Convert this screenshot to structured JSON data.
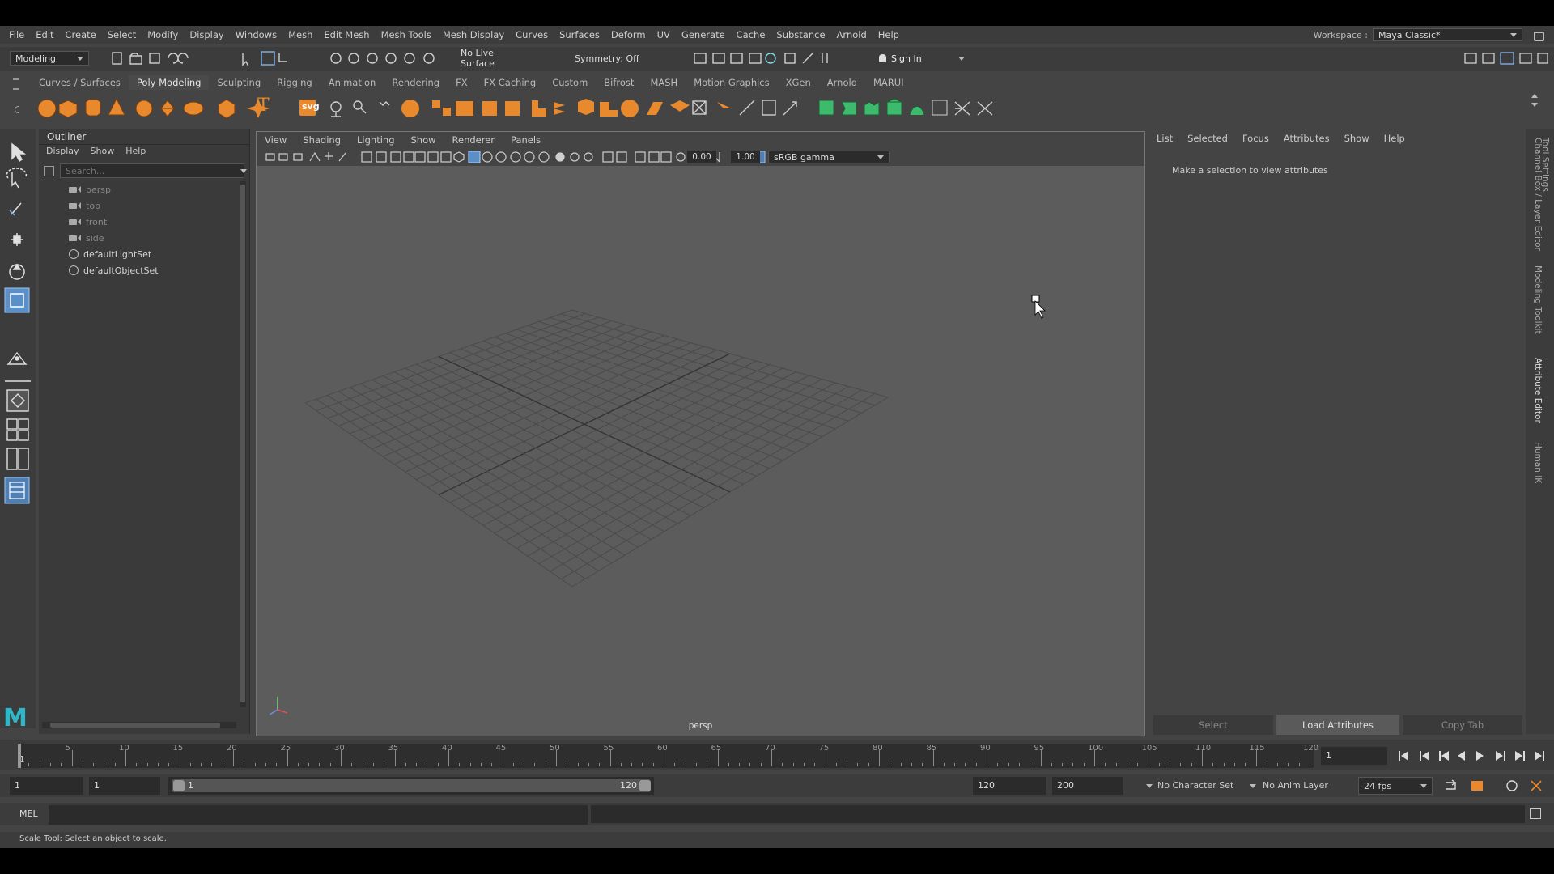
{
  "menubar": {
    "items": [
      "File",
      "Edit",
      "Create",
      "Select",
      "Modify",
      "Display",
      "Windows",
      "Mesh",
      "Edit Mesh",
      "Mesh Tools",
      "Mesh Display",
      "Curves",
      "Surfaces",
      "Deform",
      "UV",
      "Generate",
      "Cache",
      "Substance",
      "Arnold",
      "Help"
    ],
    "workspace_label": "Workspace :",
    "workspace_value": "Maya Classic*"
  },
  "statusline": {
    "mode": "Modeling",
    "live_surface": "No Live Surface",
    "symmetry": "Symmetry: Off",
    "sign_in": "Sign In"
  },
  "shelf": {
    "tabs": [
      "Curves / Surfaces",
      "Poly Modeling",
      "Sculpting",
      "Rigging",
      "Animation",
      "Rendering",
      "FX",
      "FX Caching",
      "Custom",
      "Bifrost",
      "MASH",
      "Motion Graphics",
      "XGen",
      "Arnold",
      "MARUI"
    ],
    "active_tab": "Poly Modeling",
    "text_tool_glyph": "T",
    "svg_tool_label": "svg"
  },
  "outliner": {
    "title": "Outliner",
    "menus": [
      "Display",
      "Show",
      "Help"
    ],
    "search_placeholder": "Search...",
    "items": [
      {
        "label": "persp",
        "dim": true
      },
      {
        "label": "top",
        "dim": true
      },
      {
        "label": "front",
        "dim": true
      },
      {
        "label": "side",
        "dim": true
      },
      {
        "label": "defaultLightSet",
        "dim": false
      },
      {
        "label": "defaultObjectSet",
        "dim": false
      }
    ]
  },
  "viewport": {
    "menus": [
      "View",
      "Shading",
      "Lighting",
      "Show",
      "Renderer",
      "Panels"
    ],
    "exposure": "0.00",
    "gamma": "1.00",
    "color_space": "sRGB gamma",
    "camera_label": "persp"
  },
  "attribute_editor": {
    "menus": [
      "List",
      "Selected",
      "Focus",
      "Attributes",
      "Show",
      "Help"
    ],
    "message": "Make a selection to view attributes",
    "buttons": {
      "select": "Select",
      "load": "Load Attributes",
      "copy": "Copy Tab"
    }
  },
  "side_tabs": [
    "Channel Box / Layer Editor",
    "Modeling Toolkit",
    "Attribute Editor",
    "Human IK"
  ],
  "top_right_tab": "Tool Settings",
  "timeline": {
    "ticks": [
      5,
      10,
      15,
      20,
      25,
      30,
      35,
      40,
      45,
      50,
      55,
      60,
      65,
      70,
      75,
      80,
      85,
      90,
      95,
      100,
      105,
      110,
      115,
      120
    ],
    "start_marker": "1",
    "current_frame": "1"
  },
  "range": {
    "start": "1",
    "playback_start": "1",
    "slider_start": "1",
    "slider_end": "120",
    "playback_end": "120",
    "end": "200",
    "character_set": "No Character Set",
    "anim_layer": "No Anim Layer",
    "fps": "24 fps"
  },
  "command": {
    "lang": "MEL"
  },
  "help_line": "Scale Tool: Select an object to scale.",
  "logo": "M"
}
